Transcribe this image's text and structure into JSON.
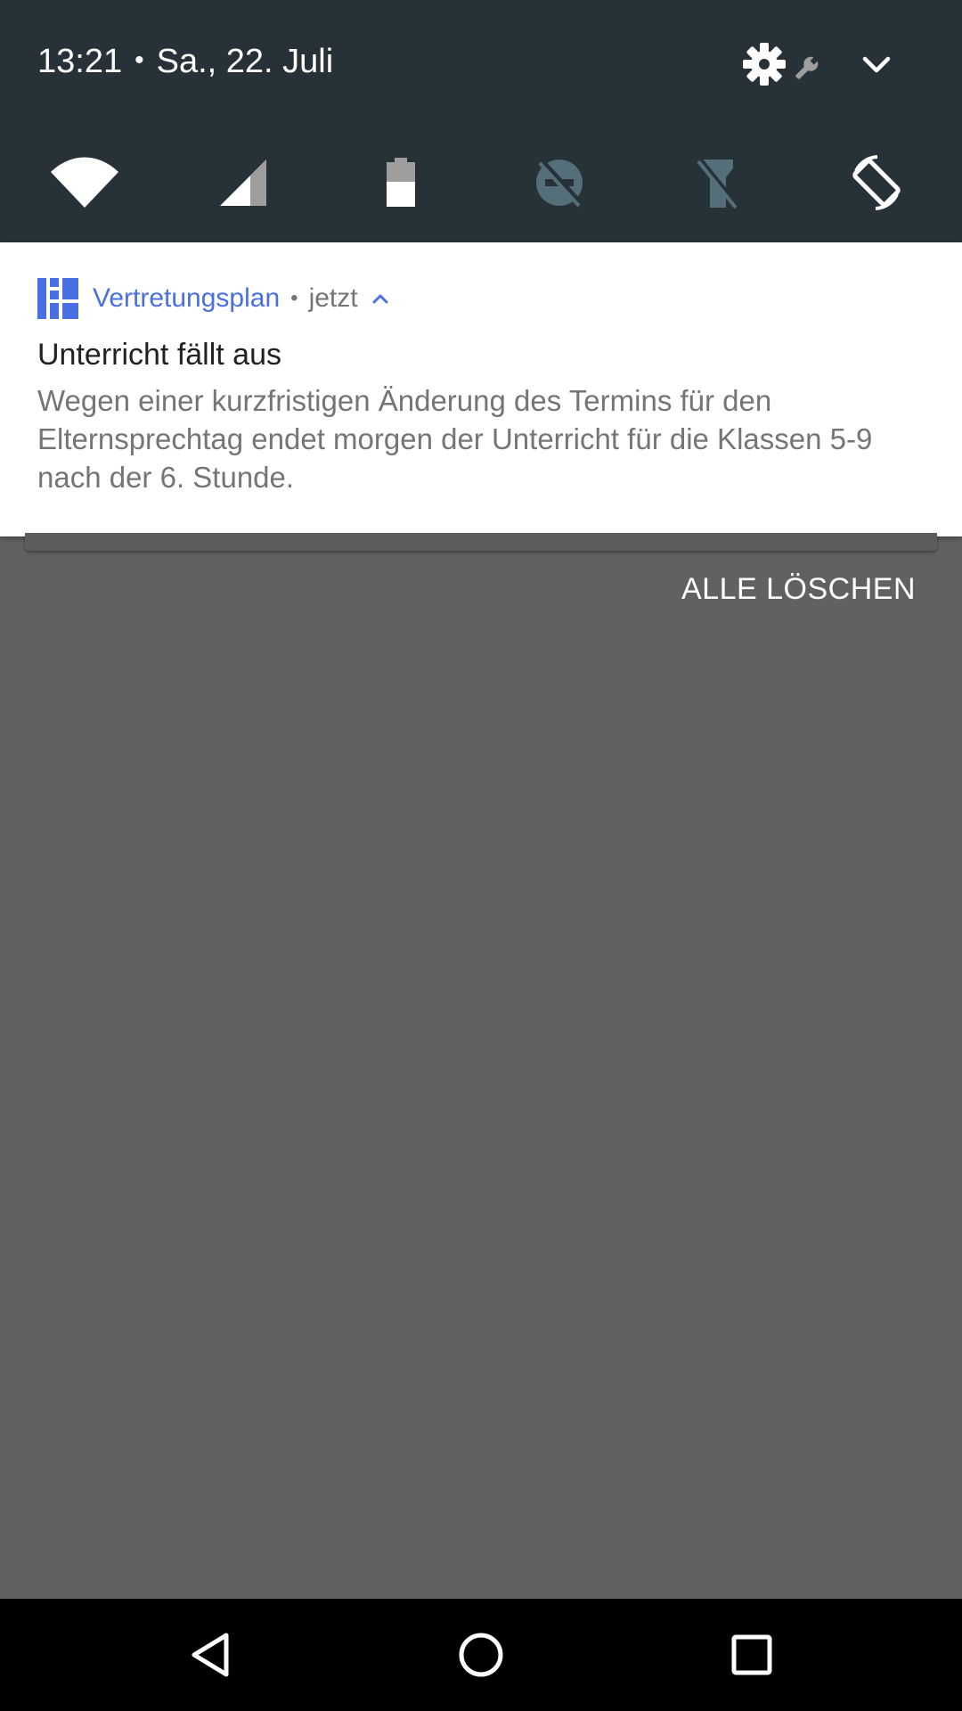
{
  "status_header": {
    "time": "13:21",
    "date": "Sa., 22. Juli"
  },
  "quick_tiles": [
    {
      "icon": "wifi-icon",
      "active": true
    },
    {
      "icon": "cellular-signal-icon",
      "active": true
    },
    {
      "icon": "battery-icon",
      "active": true
    },
    {
      "icon": "do-not-disturb-off-icon",
      "active": false
    },
    {
      "icon": "flashlight-off-icon",
      "active": false
    },
    {
      "icon": "auto-rotate-icon",
      "active": true
    }
  ],
  "notification": {
    "app_name": "Vertretungsplan",
    "separator": "•",
    "time": "jetzt",
    "title": "Unterricht fällt aus",
    "body": "Wegen einer kurzfristigen Änderung des Termins für den Elternsprechtag endet morgen der Unterricht für die Klassen 5-9 nach der 6. Stunde.",
    "accent_color": "#4a6fe3"
  },
  "clear_all_label": "ALLE LÖSCHEN",
  "colors": {
    "header_bg": "#263238",
    "scrim": "#616161",
    "card_bg": "#ffffff"
  }
}
